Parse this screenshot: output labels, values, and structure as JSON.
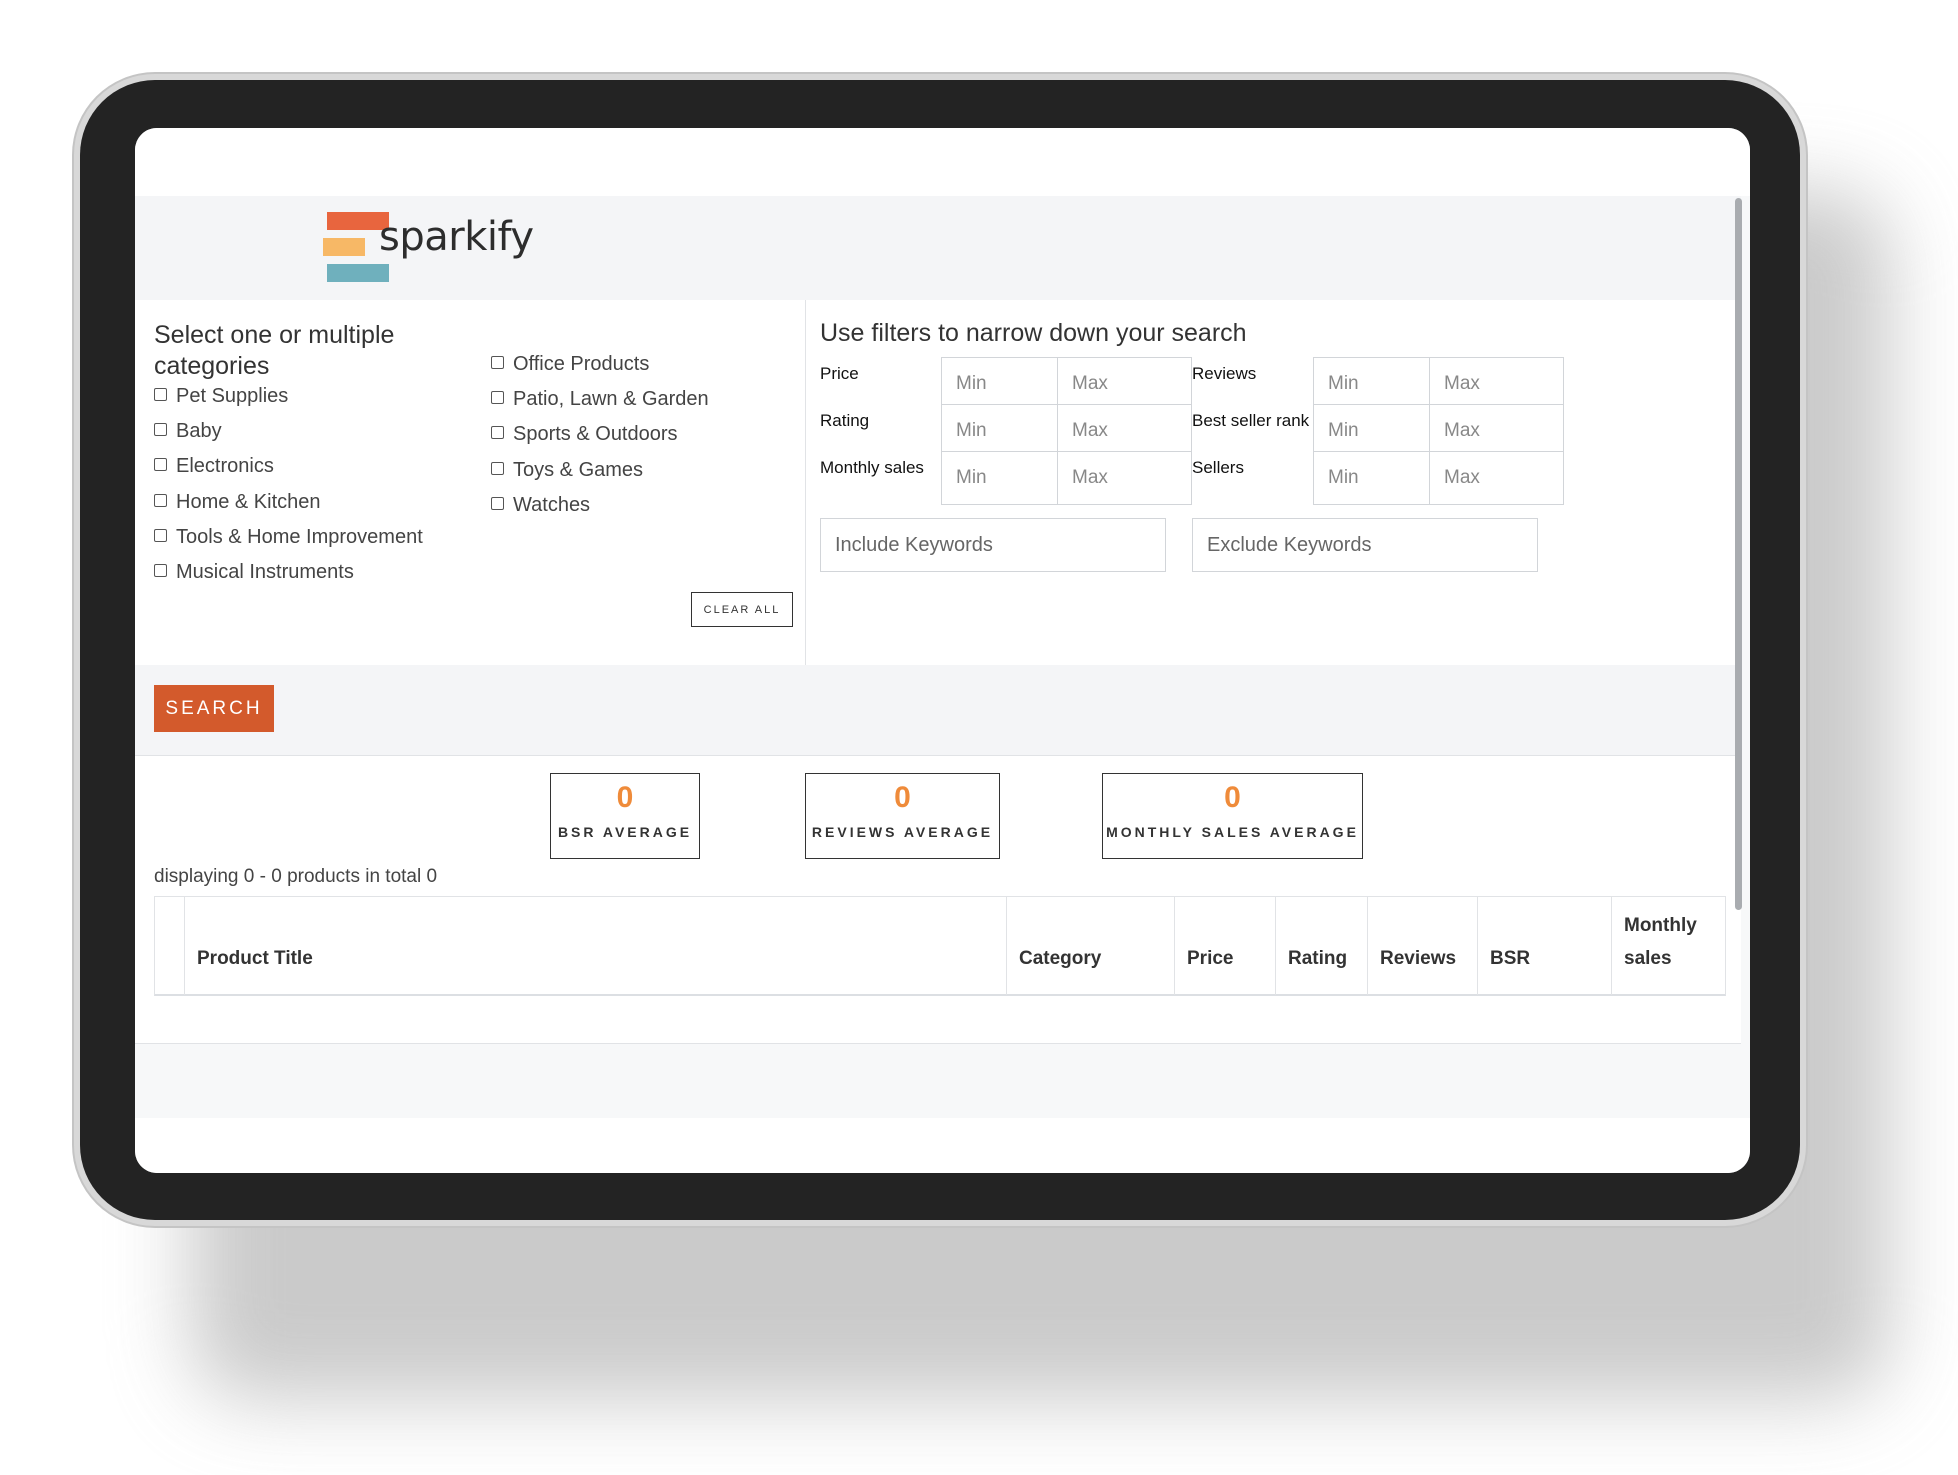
{
  "brand": {
    "name": "sparkify",
    "colors": [
      "#e8653e",
      "#f7b866",
      "#6fb0bd"
    ]
  },
  "categories": {
    "title_line1": "Select one or multiple",
    "title_line2": "categories",
    "col1": [
      "Pet Supplies",
      "Baby",
      "Electronics",
      "Home & Kitchen",
      "Tools & Home Improvement",
      "Musical Instruments"
    ],
    "col2": [
      "Office Products",
      "Patio, Lawn & Garden",
      "Sports & Outdoors",
      "Toys & Games",
      "Watches"
    ],
    "clear_label": "CLEAR ALL"
  },
  "filters": {
    "title": "Use filters to narrow down your search",
    "left": [
      {
        "label": "Price",
        "min": "Min",
        "max": "Max"
      },
      {
        "label": "Rating",
        "min": "Min",
        "max": "Max"
      },
      {
        "label": "Monthly sales",
        "min": "Min",
        "max": "Max"
      }
    ],
    "right": [
      {
        "label": "Reviews",
        "min": "Min",
        "max": "Max"
      },
      {
        "label": "Best seller rank",
        "min": "Min",
        "max": "Max"
      },
      {
        "label": "Sellers",
        "min": "Min",
        "max": "Max"
      }
    ],
    "include_placeholder": "Include Keywords",
    "exclude_placeholder": "Exclude Keywords"
  },
  "search": {
    "label": "SEARCH",
    "color": "#d35a2c"
  },
  "stats": [
    {
      "value": "0",
      "label": "BSR AVERAGE"
    },
    {
      "value": "0",
      "label": "REVIEWS AVERAGE"
    },
    {
      "value": "0",
      "label": "MONTHLY SALES AVERAGE"
    }
  ],
  "stat_color": "#ef8b3a",
  "results": {
    "displaying": "displaying 0 - 0 products in total 0",
    "columns": [
      "Product Title",
      "Category",
      "Price",
      "Rating",
      "Reviews",
      "BSR",
      "Monthly sales"
    ]
  }
}
